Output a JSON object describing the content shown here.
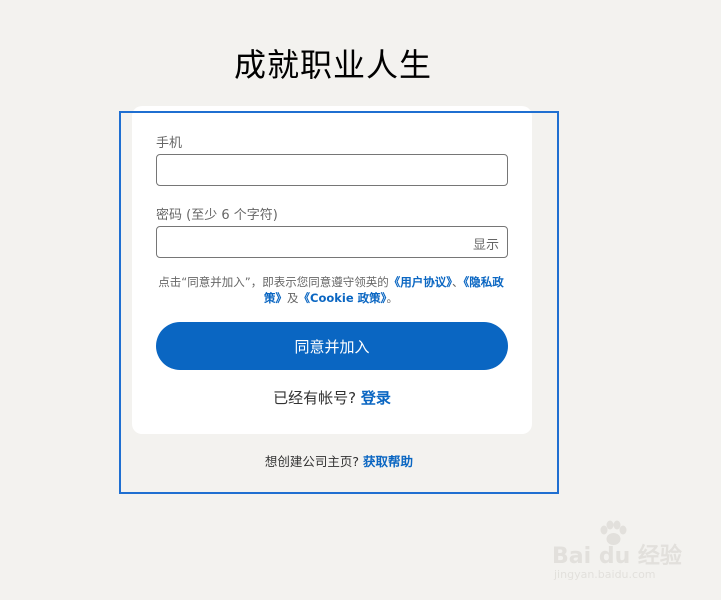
{
  "page": {
    "headline": "成就职业人生"
  },
  "form": {
    "phone_label": "手机",
    "phone_value": "",
    "password_label": "密码 (至少 6 个字符)",
    "password_value": "",
    "show_label": "显示",
    "agreement": {
      "prefix": "点击“同意并加入”，即表示您同意遵守领英的",
      "user_agreement": "《用户协议》",
      "sep1": "、",
      "privacy_policy": "《隐私政策》",
      "sep2": "及",
      "cookie_policy": "《Cookie 政策》",
      "suffix": "。"
    },
    "join_button": "同意并加入",
    "have_account": "已经有帐号?",
    "signin_link": "登录"
  },
  "footer": {
    "company_prompt": "想创建公司主页?",
    "help_link": "获取帮助"
  },
  "watermark": {
    "main": "Bai du 经验",
    "sub": "jingyan.baidu.com",
    "icon": "baidu-paw-icon"
  },
  "colors": {
    "background": "#f3f2ef",
    "brand": "#0a66c2",
    "highlight_border": "#1f6fd1"
  }
}
